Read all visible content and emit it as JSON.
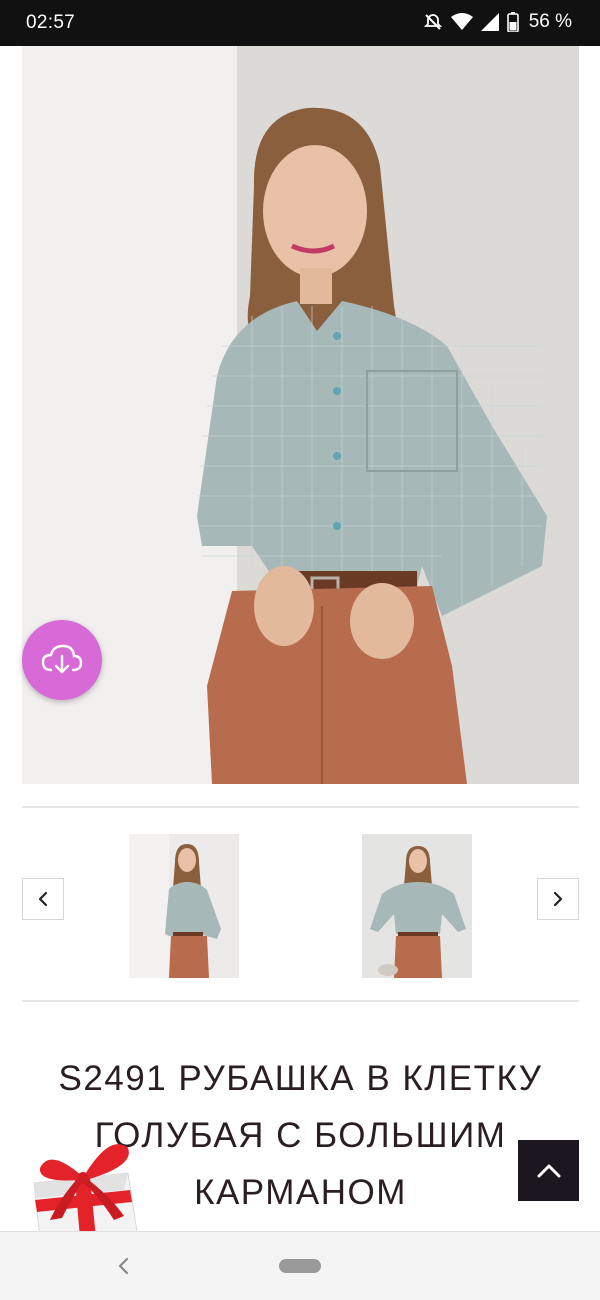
{
  "status_bar": {
    "time": "02:57",
    "battery_text": "56 %",
    "icons": [
      "mute-icon",
      "wifi-icon",
      "signal-icon",
      "battery-icon"
    ]
  },
  "gallery": {
    "download_button_icon": "cloud-download-icon",
    "prev_icon": "chevron-left-icon",
    "next_icon": "chevron-right-icon",
    "thumbnail_count": 2
  },
  "product": {
    "title": "S2491 РУБАШКА В КЛЕТКУ ГОЛУБАЯ С БОЛЬШИМ КАРМАНОМ"
  },
  "floating": {
    "gift_icon": "gift-box-icon",
    "scroll_top_icon": "chevron-up-icon"
  },
  "nav_bar": {
    "back_icon": "back-icon",
    "home_icon": "home-pill-icon"
  },
  "colors": {
    "status_bar_bg": "#111111",
    "fab_pink": "#d86ad8",
    "scroll_top_bg": "#1c1620",
    "title_text": "#2a1d24"
  }
}
